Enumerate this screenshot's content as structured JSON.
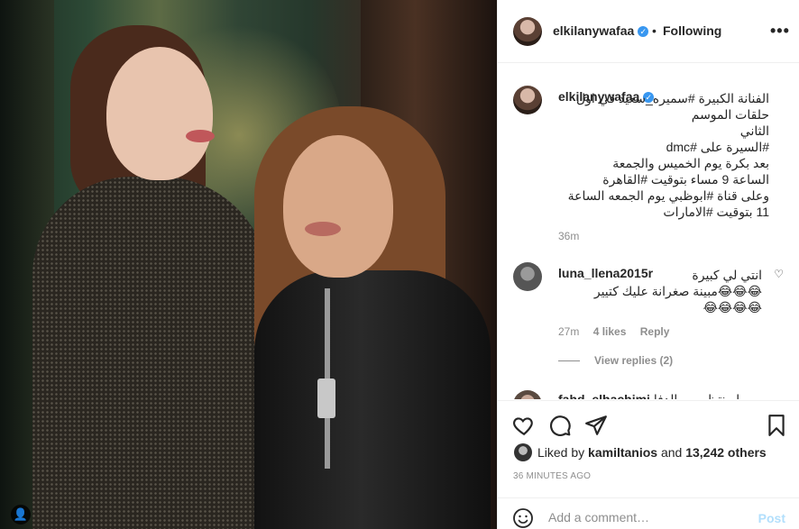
{
  "header": {
    "username": "elkilanywafaa",
    "separator": "•",
    "following_label": "Following",
    "more_label": "•••"
  },
  "caption": {
    "username": "elkilanywafaa",
    "lines": [
      "الفنانة الكبيرة #سميره_سعيد في اول حلقات الموسم",
      "الثاني",
      "#السيرة على #dmc",
      "بعد بكرة يوم الخميس والجمعة",
      "الساعة 9 مساء بتوقيت #القاهرة",
      "وعلى قناة #ابوظبي يوم الجمعه الساعة",
      "11 بتوقيت #الامارات"
    ],
    "time": "36m"
  },
  "comment": {
    "username": "luna_llena2015r",
    "lines": [
      "انتي لي كبيرة",
      "😂😂😂مبينة صغرانة عليك كتيير",
      "😂😂😂😂"
    ],
    "time": "27m",
    "likes": "4 likes",
    "reply_label": "Reply",
    "view_replies": "View replies (2)"
  },
  "comment2": {
    "username": "fahd_elhachimi",
    "text": "ما منتظر من الدفا"
  },
  "likes": {
    "prefix": "Liked by",
    "user": "kamiltanios",
    "and": "and",
    "count": "13,242 others"
  },
  "posted_time": "36 MINUTES AGO",
  "add_comment": {
    "placeholder": "Add a comment…",
    "post_label": "Post"
  },
  "colors": {
    "verified": "#3897f0",
    "hashtag": "#00376b",
    "post_disabled": "#b2dffc"
  }
}
